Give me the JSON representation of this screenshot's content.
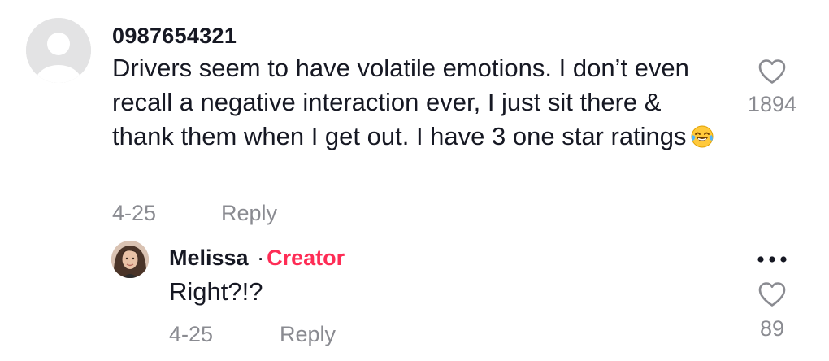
{
  "comment": {
    "username": "0987654321",
    "text": "Drivers seem to have volatile emotions. I don’t even recall a negative interaction ever, I just sit there & thank them when I get out. I have 3 one star ratings",
    "emoji": "face-with-tears-of-joy",
    "date": "4-25",
    "reply_label": "Reply",
    "like_count": "1894",
    "avatar": "default-avatar"
  },
  "reply": {
    "username": "Melissa",
    "separator": "·",
    "badge": "Creator",
    "text": "Right?!?",
    "date": "4-25",
    "reply_label": "Reply",
    "like_count": "89",
    "more_icon": "more-dots-icon"
  },
  "colors": {
    "text_primary": "#161823",
    "text_secondary": "#8a8b91",
    "creator_badge": "#fe2c55",
    "avatar_placeholder": "#e3e3e4"
  }
}
